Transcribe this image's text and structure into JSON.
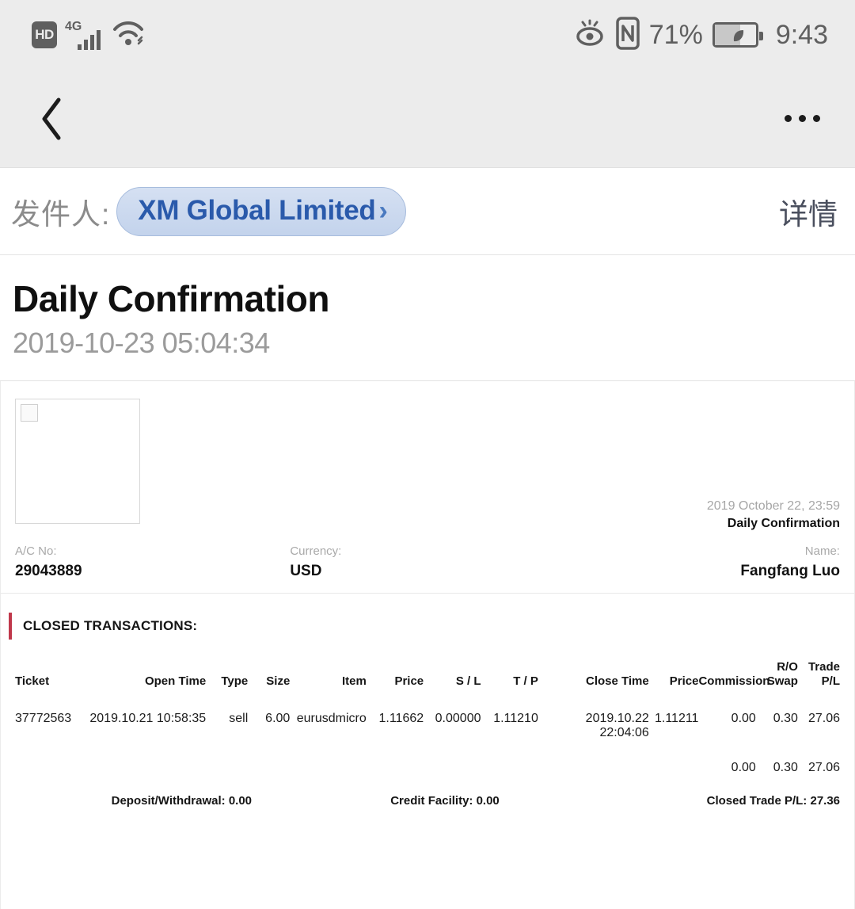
{
  "status_bar": {
    "hd_label": "HD",
    "network_label": "4G",
    "battery_percent": "71%",
    "clock": "9:43",
    "icons": [
      "hd-icon",
      "signal-icon",
      "wifi-icon",
      "eye-care-icon",
      "nfc-icon",
      "battery-icon"
    ]
  },
  "nav_bar": {
    "back_icon": "back-chevron-icon",
    "more_icon": "more-options-icon"
  },
  "sender": {
    "label": "发件人:",
    "name": "XM Global Limited",
    "chevron": "›",
    "details_label": "详情"
  },
  "message": {
    "title": "Daily Confirmation",
    "date": "2019-10-23 05:04:34"
  },
  "document": {
    "logo_placeholder": "broken-image-icon",
    "doc_date": "2019 October 22, 23:59",
    "doc_label": "Daily Confirmation",
    "account": {
      "ac_no_label": "A/C No:",
      "ac_no_value": "29043889",
      "currency_label": "Currency:",
      "currency_value": "USD",
      "name_label": "Name:",
      "name_value": "Fangfang Luo"
    },
    "section_title": "CLOSED TRANSACTIONS:",
    "accent_color": "#c0384b",
    "table": {
      "headers": [
        "Ticket",
        "Open Time",
        "Type",
        "Size",
        "Item",
        "Price",
        "S / L",
        "T / P",
        "Close Time",
        "Price",
        "Commission",
        "R/O\nSwap",
        "Trade\nP/L"
      ],
      "headers_flat": {
        "ticket": "Ticket",
        "open_time": "Open Time",
        "type": "Type",
        "size": "Size",
        "item": "Item",
        "price_open": "Price",
        "sl": "S / L",
        "tp": "T / P",
        "close_time": "Close Time",
        "price_close": "Price",
        "commission": "Commission",
        "swap_line1": "R/O",
        "swap_line2": "Swap",
        "pl_line1": "Trade",
        "pl_line2": "P/L"
      },
      "rows": [
        {
          "ticket": "37772563",
          "open_time": "2019.10.21 10:58:35",
          "type": "sell",
          "size": "6.00",
          "item": "eurusdmicro",
          "price_open": "1.11662",
          "sl": "0.00000",
          "tp": "1.11210",
          "close_time": "2019.10.22 22:04:06",
          "price_close": "1.11211",
          "commission": "0.00",
          "swap": "0.30",
          "pl": "27.06"
        }
      ],
      "totals": {
        "commission": "0.00",
        "swap": "0.30",
        "pl": "27.06"
      }
    },
    "summary": {
      "deposit_withdrawal": "Deposit/Withdrawal: 0.00",
      "credit_facility": "Credit Facility: 0.00",
      "closed_trade_pl": "Closed Trade P/L: 27.36"
    }
  }
}
